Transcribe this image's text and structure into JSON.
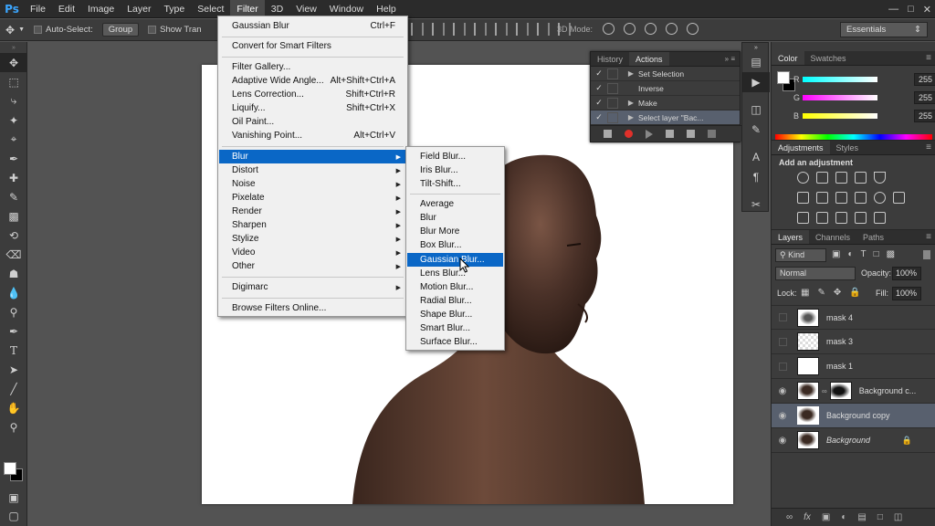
{
  "menubar": {
    "logo": "Ps",
    "items": [
      "File",
      "Edit",
      "Image",
      "Layer",
      "Type",
      "Select",
      "Filter",
      "3D",
      "View",
      "Window",
      "Help"
    ],
    "active": "Filter"
  },
  "options": {
    "auto_select_label": "Auto-Select:",
    "auto_select_value": "Group",
    "show_transform_label": "Show Tran",
    "mode3d_label": "3D Mode:",
    "workspace": "Essentials"
  },
  "filter_menu": {
    "items": [
      {
        "label": "Gaussian Blur",
        "shortcut": "Ctrl+F"
      },
      {
        "label": "Convert for Smart Filters",
        "shortcut": ""
      },
      {
        "label": "Filter Gallery...",
        "shortcut": ""
      },
      {
        "label": "Adaptive Wide Angle...",
        "shortcut": "Alt+Shift+Ctrl+A"
      },
      {
        "label": "Lens Correction...",
        "shortcut": "Shift+Ctrl+R"
      },
      {
        "label": "Liquify...",
        "shortcut": "Shift+Ctrl+X"
      },
      {
        "label": "Oil Paint...",
        "shortcut": ""
      },
      {
        "label": "Vanishing Point...",
        "shortcut": "Alt+Ctrl+V"
      },
      {
        "label": "Blur",
        "shortcut": ""
      },
      {
        "label": "Distort",
        "shortcut": ""
      },
      {
        "label": "Noise",
        "shortcut": ""
      },
      {
        "label": "Pixelate",
        "shortcut": ""
      },
      {
        "label": "Render",
        "shortcut": ""
      },
      {
        "label": "Sharpen",
        "shortcut": ""
      },
      {
        "label": "Stylize",
        "shortcut": ""
      },
      {
        "label": "Video",
        "shortcut": ""
      },
      {
        "label": "Other",
        "shortcut": ""
      },
      {
        "label": "Digimarc",
        "shortcut": ""
      },
      {
        "label": "Browse Filters Online...",
        "shortcut": ""
      }
    ]
  },
  "blur_menu": {
    "items": [
      "Field Blur...",
      "Iris Blur...",
      "Tilt-Shift...",
      "Average",
      "Blur",
      "Blur More",
      "Box Blur...",
      "Gaussian Blur...",
      "Lens Blur...",
      "Motion Blur...",
      "Radial Blur...",
      "Shape Blur...",
      "Smart Blur...",
      "Surface Blur..."
    ],
    "highlighted": "Gaussian Blur..."
  },
  "history_panel": {
    "tabs": [
      "History",
      "Actions"
    ],
    "active_tab": "Actions",
    "rows": [
      "Set Selection",
      "Inverse",
      "Make",
      "Select layer \"Bac..."
    ]
  },
  "color_panel": {
    "tabs": [
      "Color",
      "Swatches"
    ],
    "channels": [
      {
        "label": "R",
        "value": "255"
      },
      {
        "label": "G",
        "value": "255"
      },
      {
        "label": "B",
        "value": "255"
      }
    ]
  },
  "adjustments_panel": {
    "tabs": [
      "Adjustments",
      "Styles"
    ],
    "heading": "Add an adjustment"
  },
  "layers_panel": {
    "tabs": [
      "Layers",
      "Channels",
      "Paths"
    ],
    "kind": "Kind",
    "blend_mode": "Normal",
    "opacity_label": "Opacity:",
    "opacity": "100%",
    "lock_label": "Lock:",
    "fill_label": "Fill:",
    "fill": "100%",
    "layers": [
      {
        "name": "mask 4",
        "visible": false
      },
      {
        "name": "mask 3",
        "visible": false
      },
      {
        "name": "mask 1",
        "visible": false
      },
      {
        "name": "Background c...",
        "visible": true
      },
      {
        "name": "Background copy",
        "visible": true
      },
      {
        "name": "Background",
        "visible": true
      }
    ],
    "selected": "Background copy"
  },
  "colors": {
    "menu_highlight": "#0a67c6",
    "app_bg": "#535353",
    "panel_bg": "#3c3c3c",
    "skin": "#4a3128"
  }
}
